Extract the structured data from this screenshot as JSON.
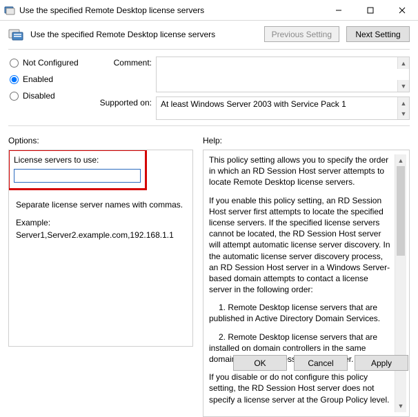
{
  "window": {
    "title": "Use the specified Remote Desktop license servers"
  },
  "header": {
    "title": "Use the specified Remote Desktop license servers",
    "prev_button": "Previous Setting",
    "next_button": "Next Setting"
  },
  "state": {
    "not_configured": "Not Configured",
    "enabled": "Enabled",
    "disabled": "Disabled",
    "selected": "enabled"
  },
  "meta": {
    "comment_label": "Comment:",
    "comment_value": "",
    "supported_label": "Supported on:",
    "supported_value": "At least Windows Server 2003 with Service Pack 1"
  },
  "sections": {
    "options_label": "Options:",
    "help_label": "Help:"
  },
  "options": {
    "field_label": "License servers to use:",
    "field_value": "",
    "hint1": "Separate license server names with commas.",
    "hint2": "Example: Server1,Server2.example.com,192.168.1.1"
  },
  "help": {
    "p1": "This policy setting allows you to specify the order in which an RD Session Host server attempts to locate Remote Desktop license servers.",
    "p2": "If you enable this policy setting, an RD Session Host server first attempts to locate the specified license servers. If the specified license servers cannot be located, the RD Session Host server will attempt automatic license server discovery. In the automatic license server discovery process, an RD Session Host server in a Windows Server-based domain attempts to contact a license server in the following order:",
    "p3": "1. Remote Desktop license servers that are published in Active Directory Domain Services.",
    "p4": "2. Remote Desktop license servers that are installed on domain controllers in the same domain as the RD Session Host server.",
    "p5": "If you disable or do not configure this policy setting, the RD Session Host server does not specify a license server at the Group Policy level."
  },
  "footer": {
    "ok": "OK",
    "cancel": "Cancel",
    "apply": "Apply"
  }
}
